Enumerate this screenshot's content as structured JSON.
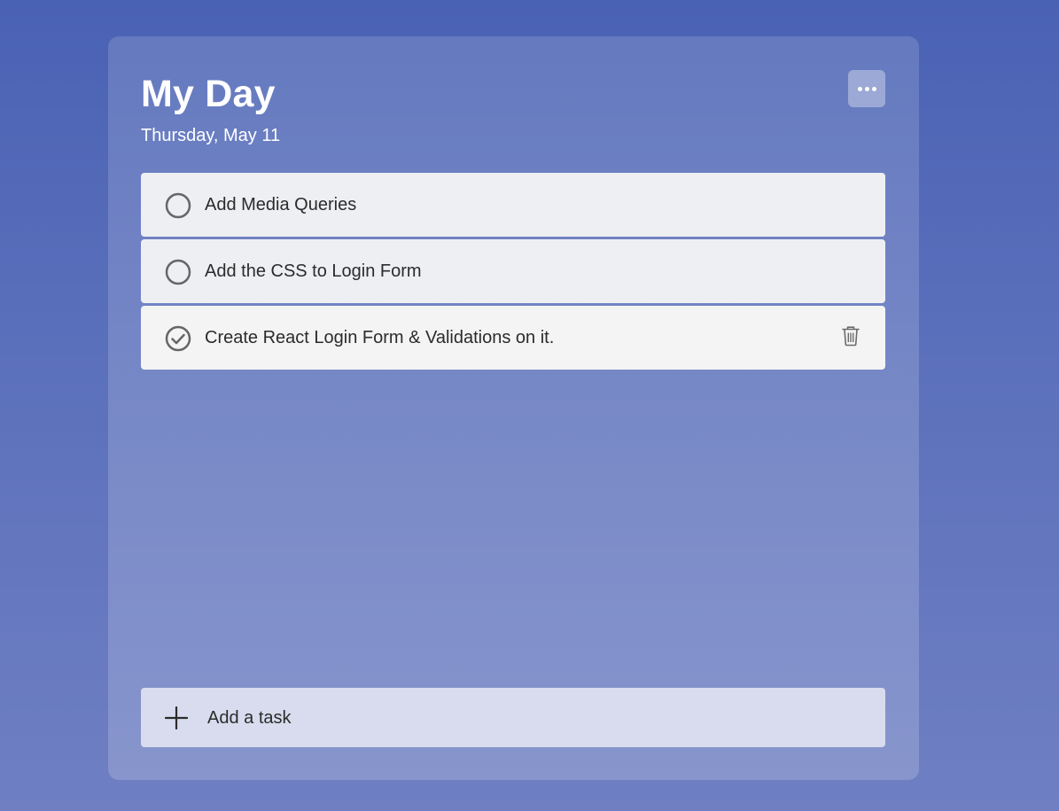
{
  "header": {
    "title": "My Day",
    "date": "Thursday, May 11"
  },
  "menu": {
    "icon": "more-horizontal-icon"
  },
  "tasks": [
    {
      "label": "Add Media Queries",
      "completed": false
    },
    {
      "label": "Add the CSS to Login Form",
      "completed": false
    },
    {
      "label": "Create React Login Form & Validations on it.",
      "completed": true
    }
  ],
  "add_task": {
    "label": "Add a task",
    "icon": "plus-icon"
  },
  "colors": {
    "background_top": "#4a62b4",
    "background_bottom": "#6f7fc2",
    "task_bg": "#eeeff3",
    "completed_task_bg": "#f4f4f4",
    "add_task_bg": "#d8dcee",
    "icon_gray": "#666666"
  }
}
